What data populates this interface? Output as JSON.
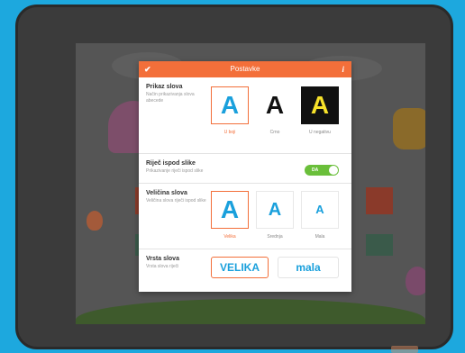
{
  "dialog": {
    "title": "Postavke",
    "confirm_icon": "check-icon",
    "info_icon": "info-icon"
  },
  "letter_display": {
    "title": "Prikaz slova",
    "description": "Način prikazivanja slova abecede",
    "options": [
      {
        "glyph": "A",
        "label": "U boji",
        "selected": true
      },
      {
        "glyph": "A",
        "label": "Crno",
        "selected": false
      },
      {
        "glyph": "A",
        "label": "U negativu",
        "selected": false
      }
    ]
  },
  "word_below": {
    "title": "Riječ ispod slike",
    "description": "Prikazivanje riječi ispod slike",
    "toggle_label": "DA",
    "enabled": true
  },
  "letter_size": {
    "title": "Veličina slova",
    "description": "Veličina slova riječi ispod slike",
    "options": [
      {
        "glyph": "A",
        "label": "Velika",
        "selected": true
      },
      {
        "glyph": "A",
        "label": "Srednja",
        "selected": false
      },
      {
        "glyph": "A",
        "label": "Mala",
        "selected": false
      }
    ]
  },
  "letter_case": {
    "title": "Vrsta slova",
    "description": "Vrsta slova riječi",
    "options": [
      {
        "label": "VELIKA",
        "selected": true
      },
      {
        "label": "mala",
        "selected": false
      }
    ]
  },
  "colors": {
    "accent": "#f36f3a",
    "letter_blue": "#1aa0dc",
    "toggle_green": "#6abf3a",
    "negative_yellow": "#f7e22a"
  }
}
